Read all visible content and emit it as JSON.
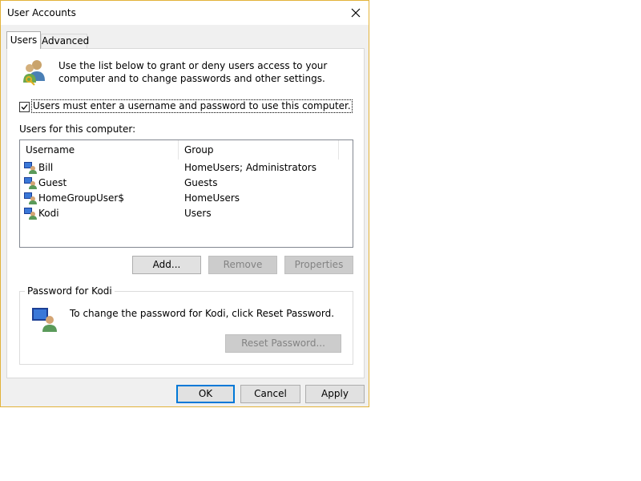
{
  "window": {
    "title": "User Accounts",
    "close_glyph": "✕"
  },
  "tabs": [
    {
      "label": "Users",
      "active": true
    },
    {
      "label": "Advanced",
      "active": false
    }
  ],
  "users_tab": {
    "intro_text": "Use the list below to grant or deny users access to your computer and to change passwords and other settings.",
    "require_login_checkbox": {
      "label": "Users must enter a username and password to use this computer.",
      "checked": true
    },
    "users_list_label": "Users for this computer:",
    "list": {
      "columns": [
        "Username",
        "Group"
      ],
      "rows": [
        {
          "username": "Bill",
          "group": "HomeUsers; Administrators"
        },
        {
          "username": "Guest",
          "group": "Guests"
        },
        {
          "username": "HomeGroupUser$",
          "group": "HomeUsers"
        },
        {
          "username": "Kodi",
          "group": "Users"
        }
      ]
    },
    "buttons": {
      "add": "Add...",
      "remove": "Remove",
      "properties": "Properties"
    },
    "password_group": {
      "title": "Password for Kodi",
      "text": "To change the password for Kodi, click Reset Password.",
      "reset_button": "Reset Password..."
    }
  },
  "footer": {
    "ok": "OK",
    "cancel": "Cancel",
    "apply": "Apply"
  },
  "colors": {
    "window_border": "#e3b33a",
    "dialog_bg": "#f0f0f0",
    "default_button_border": "#0078d7"
  },
  "icons": [
    "close-icon",
    "users-keys-icon",
    "checkmark-icon",
    "user-icon",
    "user-account-icon"
  ]
}
